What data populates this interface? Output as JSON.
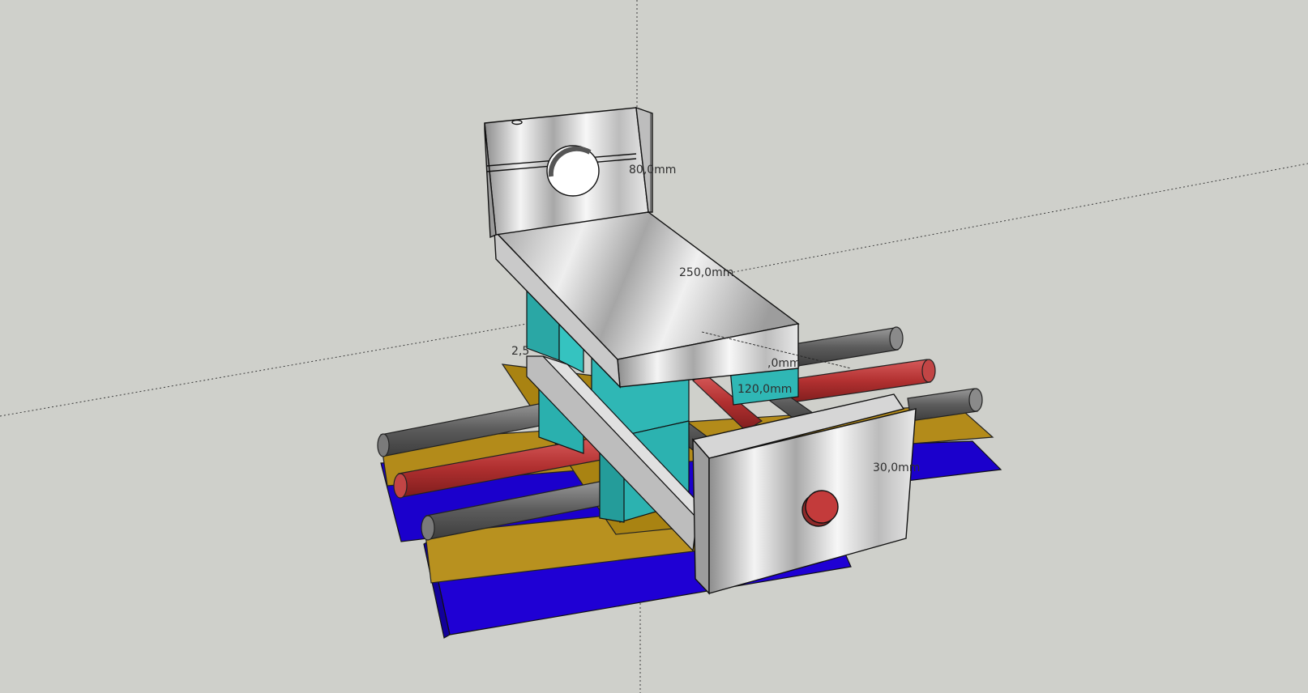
{
  "viewport": {
    "background": "#cfd0cb",
    "dimensions": {
      "top_height": "80,0mm",
      "arm_length": "250,0mm",
      "left_partial": "2,5",
      "right_partial": ",0mm",
      "carriage_width": "120,0mm",
      "front_plate": "30,0mm"
    }
  },
  "colors": {
    "aluminium_light": "#f1f1f1",
    "aluminium_mid": "#c2c2c2",
    "aluminium_dark": "#8a8a8a",
    "teal_block": "#2fb7b5",
    "gold_rail": "#b48c1c",
    "blue_base": "#1e00d2",
    "red_rod": "#b53232",
    "grey_rod": "#6c6c6c"
  }
}
